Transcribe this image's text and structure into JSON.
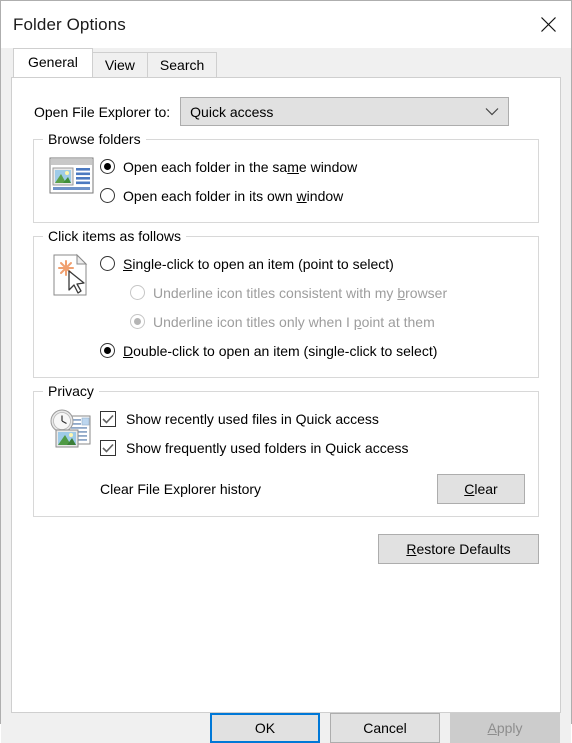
{
  "window": {
    "title": "Folder Options",
    "close_icon": "close-icon"
  },
  "tabs": [
    {
      "label": "General",
      "active": true
    },
    {
      "label": "View",
      "active": false
    },
    {
      "label": "Search",
      "active": false
    }
  ],
  "explorer_row": {
    "label": "Open File Explorer to:",
    "combo_value": "Quick access",
    "combo_icon": "chevron-down-icon"
  },
  "browse_folders": {
    "legend": "Browse folders",
    "icon": "folder-window-icon",
    "options": [
      {
        "pre": "Open each folder in the sa",
        "accel": "m",
        "post": "e window",
        "checked": true
      },
      {
        "pre": "Open each folder in its own ",
        "accel": "w",
        "post": "indow",
        "checked": false
      }
    ]
  },
  "click_items": {
    "legend": "Click items as follows",
    "icon": "click-pointer-icon",
    "options": [
      {
        "pre": "",
        "accel": "S",
        "post": "ingle-click to open an item (point to select)",
        "checked": false,
        "disabled": false,
        "sub": false
      },
      {
        "pre": "Underline icon titles consistent with my ",
        "accel": "b",
        "post": "rowser",
        "checked": false,
        "disabled": true,
        "sub": true
      },
      {
        "pre": "Underline icon titles only when I ",
        "accel": "p",
        "post": "oint at them",
        "checked": true,
        "disabled": true,
        "sub": true
      },
      {
        "pre": "",
        "accel": "D",
        "post": "ouble-click to open an item (single-click to select)",
        "checked": true,
        "disabled": false,
        "sub": false
      }
    ]
  },
  "privacy": {
    "legend": "Privacy",
    "icon": "clock-files-icon",
    "checkboxes": [
      {
        "label": "Show recently used files in Quick access",
        "checked": true
      },
      {
        "label": "Show frequently used folders in Quick access",
        "checked": true
      }
    ],
    "clear_label": "Clear File Explorer history",
    "clear_button": {
      "pre": "",
      "accel": "C",
      "post": "lear"
    }
  },
  "restore_button": {
    "pre": "",
    "accel": "R",
    "post": "estore Defaults"
  },
  "footer": {
    "ok": "OK",
    "cancel": "Cancel",
    "apply": {
      "pre": "",
      "accel": "A",
      "post": "pply"
    }
  },
  "colors": {
    "accent": "#0078d7",
    "dialog_bg": "#f0f0f0",
    "panel_bg": "#ffffff",
    "button_bg": "#e1e1e1",
    "disabled_text": "#8d8d8d"
  }
}
